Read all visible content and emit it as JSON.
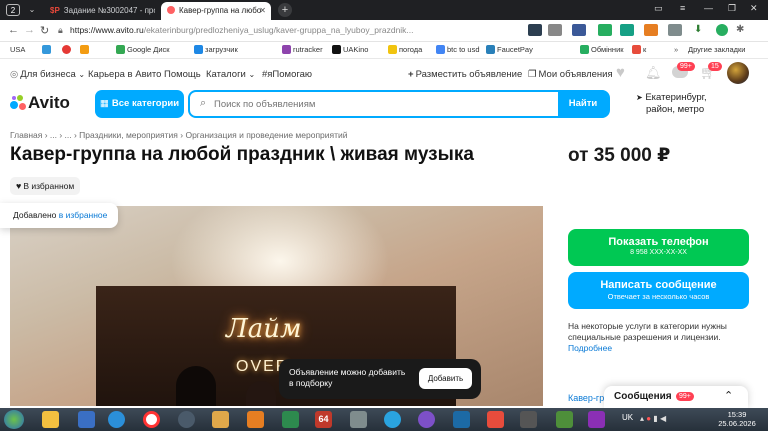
{
  "browser": {
    "tab_counter": "2",
    "tabs": [
      {
        "label": "Задание №3002047 - про"
      },
      {
        "label": "Кавер-группа на любо"
      }
    ],
    "url_host": "https://www.avito.ru",
    "url_path": "/ekaterinburg/predlozheniya_uslug/kaver-gruppa_na_lyuboy_prazdnik..."
  },
  "bookmarks": {
    "items": [
      "USA",
      "Google Диск",
      "загрузчик",
      "rutracker",
      "UAKino",
      "погода",
      "btc to usd",
      "FaucetPay",
      "Обмінник",
      "к"
    ],
    "other": "Другие закладки"
  },
  "topnav": {
    "for_business": "Для бизнеса",
    "career": "Карьера в Авито",
    "help": "Помощь",
    "catalogs": "Каталоги",
    "tag": "#яПомогаю",
    "post_ad": "Разместить объявление",
    "my_ads": "Мои объявления",
    "badge_messages": "99+",
    "badge_cart": "15"
  },
  "header": {
    "logo": "Avito",
    "all_categories": "Все категории",
    "search_placeholder": "Поиск по объявлениям",
    "find_button": "Найти",
    "location_line1": "Екатеринбург,",
    "location_line2": "район, метро"
  },
  "listing": {
    "breadcrumbs": "Главная › ... › ... › Праздники, мероприятия › Организация и проведение мероприятий",
    "title": "Кавер-группа на любой праздник \\ живая музыка",
    "price": "от 35 000 ₽",
    "favorite_button": "В избранном",
    "added_toast_prefix": "Добавлено",
    "added_toast_link": "в избранное",
    "neon_text": "Лайм",
    "neon_sub": "OVER"
  },
  "sidebar": {
    "show_phone": "Показать телефон",
    "phone_masked": "8 958 XXX-XX-XX",
    "write_message": "Написать сообщение",
    "write_message_sub": "Отвечает за несколько часов",
    "note": "На некоторые услуги в категории нужны специальные разрешения и лицензии.",
    "note_link": "Подробнее",
    "related_link": "Кавер-группа"
  },
  "toast": {
    "text": "Объявление можно добавить в подборку",
    "button": "Добавить"
  },
  "messages_panel": {
    "label": "Сообщения",
    "badge": "99+"
  },
  "taskbar": {
    "lang": "UK",
    "time": "15:39",
    "date": "25.06.2026",
    "app_badge": "64"
  },
  "colors": {
    "accent": "#00aaff",
    "green": "#00c853",
    "badge_red": "#ff4053"
  }
}
